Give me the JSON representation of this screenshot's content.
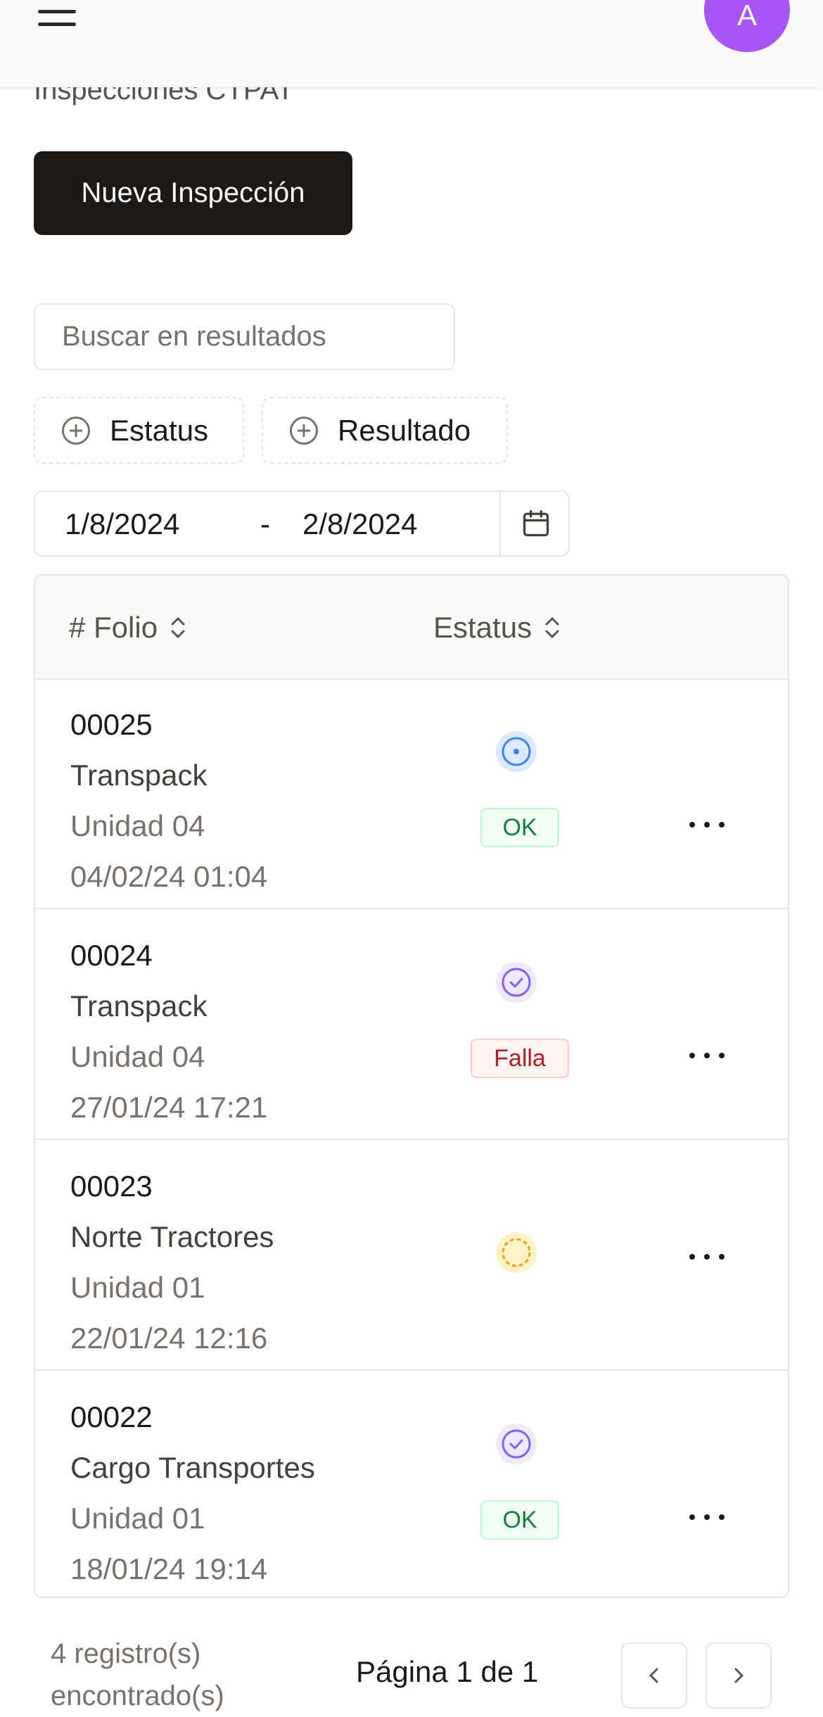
{
  "header": {
    "menu_icon": "hamburger-menu-icon",
    "avatar_initial": "A",
    "avatar_color": "#a855f7"
  },
  "page": {
    "title": "Inspecciones CTPAT",
    "new_button_label": "Nueva Inspección"
  },
  "search": {
    "placeholder": "Buscar en resultados",
    "value": ""
  },
  "filters": {
    "status_label": "Estatus",
    "result_label": "Resultado",
    "icon": "plus-circle-icon"
  },
  "date_range": {
    "start": "1/8/2024",
    "separator": "-",
    "end": "2/8/2024",
    "icon": "calendar-icon"
  },
  "table": {
    "columns": [
      "# Folio",
      "Estatus"
    ],
    "sort_icon": "chevrons-up-down-icon",
    "rows": [
      {
        "folio": "00025",
        "cliente": "Transpack",
        "unidad": "Unidad 04",
        "fecha": "04/02/24 01:04",
        "status_icon": "in-progress-circle-icon",
        "status_color": "#3b82f6",
        "result": "OK",
        "result_type": "ok"
      },
      {
        "folio": "00024",
        "cliente": "Transpack",
        "unidad": "Unidad 04",
        "fecha": "27/01/24 17:21",
        "status_icon": "check-circle-icon",
        "status_color": "#8b5cf6",
        "result": "Falla",
        "result_type": "fail"
      },
      {
        "folio": "00023",
        "cliente": "Norte Tractores",
        "unidad": "Unidad 01",
        "fecha": "22/01/24 12:16",
        "status_icon": "pending-dashed-circle-icon",
        "status_color": "#f59e0b",
        "result": "",
        "result_type": "none"
      },
      {
        "folio": "00022",
        "cliente": "Cargo Transportes",
        "unidad": "Unidad 01",
        "fecha": "18/01/24 19:14",
        "status_icon": "check-circle-icon",
        "status_color": "#8b5cf6",
        "result": "OK",
        "result_type": "ok"
      }
    ]
  },
  "footer": {
    "count_line1": "4 registro(s)",
    "count_line2": "encontrado(s)",
    "page_label": "Página 1 de 1",
    "prev_icon": "chevron-left-icon",
    "next_icon": "chevron-right-icon"
  }
}
